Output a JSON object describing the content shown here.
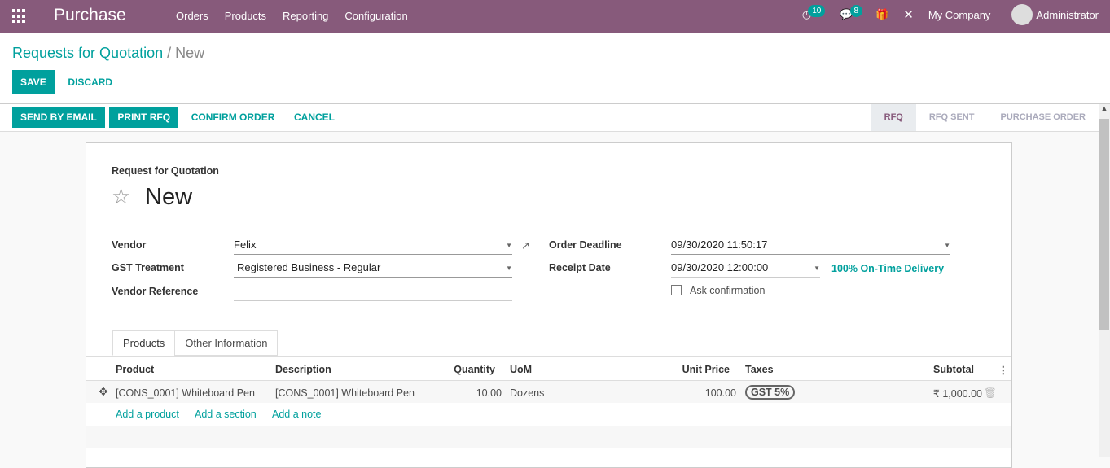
{
  "app": {
    "title": "Purchase",
    "menu": [
      "Orders",
      "Products",
      "Reporting",
      "Configuration"
    ],
    "activity_count": "10",
    "message_count": "8",
    "company": "My Company",
    "user": "Administrator"
  },
  "breadcrumb": {
    "parent": "Requests for Quotation",
    "sep": "/",
    "current": "New"
  },
  "buttons": {
    "save": "SAVE",
    "discard": "DISCARD",
    "send": "SEND BY EMAIL",
    "print": "PRINT RFQ",
    "confirm": "CONFIRM ORDER",
    "cancel": "CANCEL"
  },
  "status": [
    "RFQ",
    "RFQ SENT",
    "PURCHASE ORDER"
  ],
  "form": {
    "kind": "Request for Quotation",
    "name": "New",
    "vendor_label": "Vendor",
    "vendor": "Felix",
    "gst_label": "GST Treatment",
    "gst": "Registered Business - Regular",
    "ref_label": "Vendor Reference",
    "deadline_label": "Order Deadline",
    "deadline": "09/30/2020 11:50:17",
    "receipt_label": "Receipt Date",
    "receipt": "09/30/2020 12:00:00",
    "ontime": "100% On-Time Delivery",
    "ask": "Ask confirmation"
  },
  "tabs": [
    "Products",
    "Other Information"
  ],
  "table": {
    "headers": [
      "Product",
      "Description",
      "Quantity",
      "UoM",
      "Unit Price",
      "Taxes",
      "Subtotal"
    ],
    "row": {
      "product": "[CONS_0001] Whiteboard Pen",
      "description": "[CONS_0001] Whiteboard Pen",
      "qty": "10.00",
      "uom": "Dozens",
      "price": "100.00",
      "tax": "GST 5%",
      "subtotal": "₹ 1,000.00"
    },
    "add": [
      "Add a product",
      "Add a section",
      "Add a note"
    ]
  }
}
